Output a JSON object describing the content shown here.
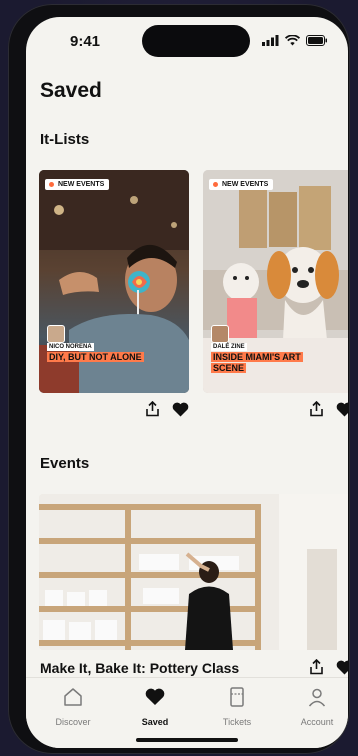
{
  "status": {
    "time": "9:41"
  },
  "page": {
    "title": "Saved"
  },
  "sections": {
    "it_lists": "It-Lists",
    "events": "Events"
  },
  "it_lists": [
    {
      "badge": "NEW EVENTS",
      "curator": "NICO NORENA",
      "caption": "DIY, BUT NOT ALONE"
    },
    {
      "badge": "NEW EVENTS",
      "curator": "DALÉ ZINE",
      "caption_line1": "INSIDE MIAMI'S ART",
      "caption_line2": "SCENE"
    }
  ],
  "events": [
    {
      "title": "Make It, Bake It: Pottery Class"
    }
  ],
  "tabs": [
    {
      "label": "Discover",
      "icon": "home-icon"
    },
    {
      "label": "Saved",
      "icon": "heart-icon"
    },
    {
      "label": "Tickets",
      "icon": "ticket-icon"
    },
    {
      "label": "Account",
      "icon": "user-icon"
    }
  ],
  "colors": {
    "accent": "#ff6b3d",
    "background": "#f4f3ef"
  }
}
